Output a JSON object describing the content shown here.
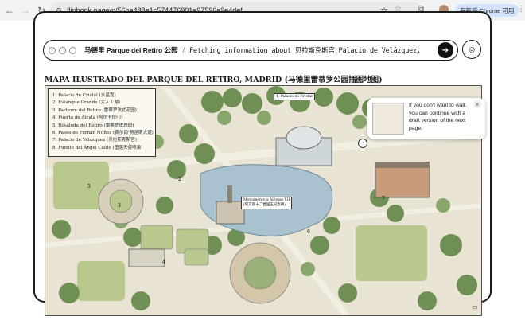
{
  "browser": {
    "url": "flipbook.page/n/56ba488e1c574476901a97596a9e4def",
    "update_label": "有新版 Chrome 可用"
  },
  "app": {
    "title": "马德里 Parque del Retiro 公园",
    "status": "Fetching information about 贝拉斯克斯宫 Palacio de Velázquez."
  },
  "map": {
    "title": "MAPA ILUSTRADO DEL PARQUE DEL RETIRO, MADRID (马德里雷蒂罗公园插图地图)",
    "legend": [
      "1. Palacio de Cristal (水晶宫)",
      "2. Estanque Grande (大人工湖)",
      "3. Parterre del Retiro (雷蒂罗法式花园)",
      "4. Puerta de Alcalá (阿尔卡拉门)",
      "5. Rosaleda del Retiro (雷蒂罗玫瑰园)",
      "6. Paseo de Fernán Núñez (费尔南·努涅斯大道)",
      "7. Palacio de Velázquez (贝拉斯克斯宫)",
      "8. Fuente del Ángel Caído (堕落天使喷泉)"
    ],
    "labels": {
      "palacio": "1. Palacio de Cristal",
      "monument_line1": "Monumento a Alfonso XII",
      "monument_line2": "(阿方索十二世国王纪念碑)"
    },
    "numbers": [
      "2",
      "3",
      "4",
      "5",
      "6",
      "7"
    ]
  },
  "tooltip": {
    "text": "If you don't want to wait, you can continue with a draft version of the next page."
  },
  "colors": {
    "water": "#a8c3cf",
    "tree": "#6f8f55",
    "path": "#e9e4d6",
    "grass": "#b9c98e"
  }
}
